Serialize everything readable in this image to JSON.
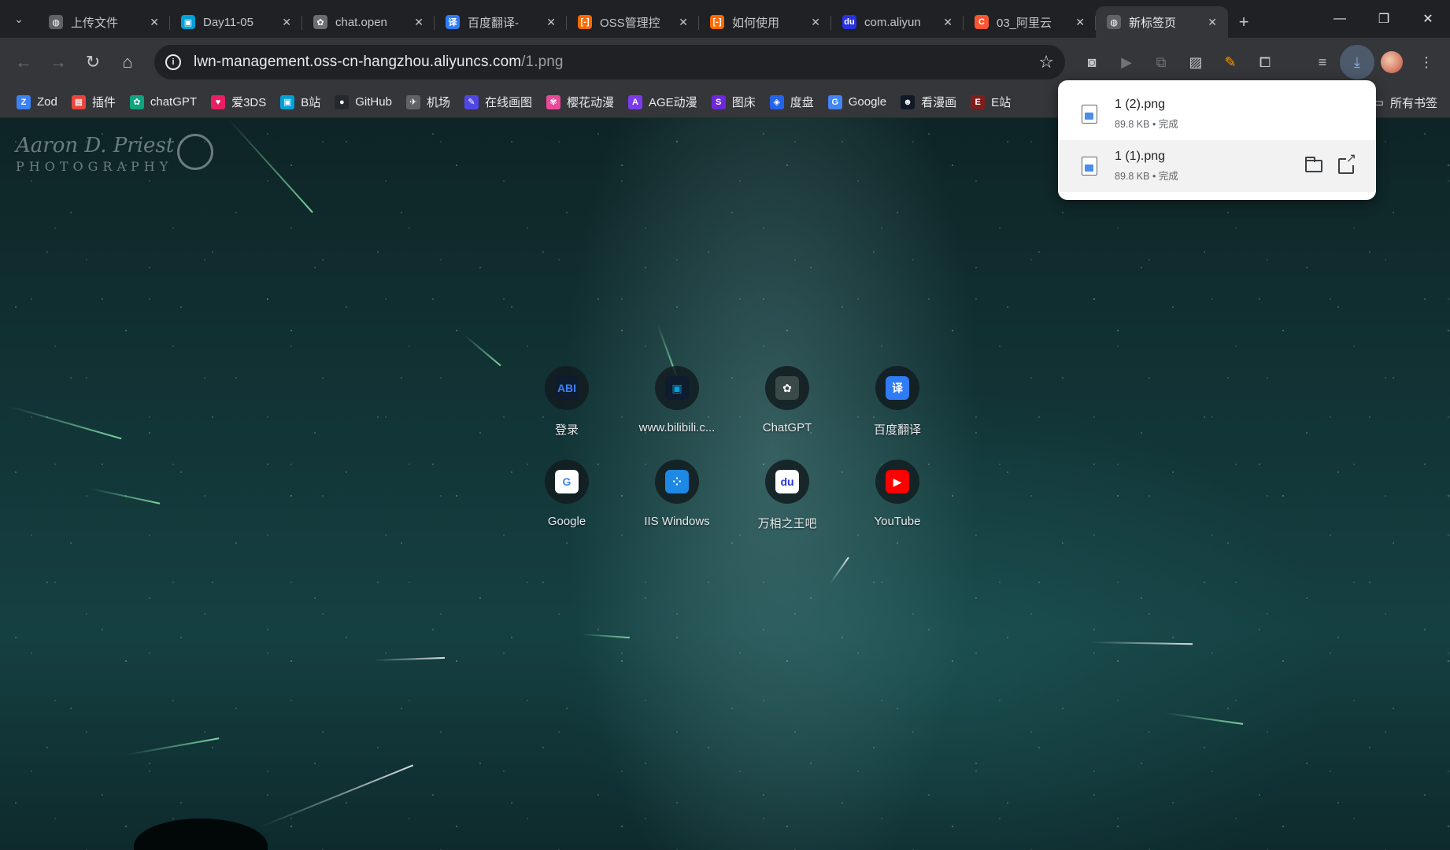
{
  "tabs": [
    {
      "title": "上传文件",
      "favicon": "globe-icon",
      "color": "#5f6368",
      "glyph": "◍"
    },
    {
      "title": "Day11-05",
      "favicon": "bilibili-icon",
      "color": "#00a1d6",
      "glyph": "▣"
    },
    {
      "title": "chat.open",
      "favicon": "openai-icon",
      "color": "#6b6f73",
      "glyph": "✿"
    },
    {
      "title": "百度翻译-",
      "favicon": "translate-icon",
      "color": "#2f7cf6",
      "glyph": "译"
    },
    {
      "title": "OSS管理控",
      "favicon": "aliyun-icon",
      "color": "#ff6a00",
      "glyph": "[-]"
    },
    {
      "title": "如何使用",
      "favicon": "aliyun-icon",
      "color": "#ff6a00",
      "glyph": "[-]"
    },
    {
      "title": "com.aliyun",
      "favicon": "baidu-icon",
      "color": "#2932e1",
      "glyph": "du"
    },
    {
      "title": "03_阿里云",
      "favicon": "csdn-icon",
      "color": "#fc5531",
      "glyph": "C"
    },
    {
      "title": "新标签页",
      "favicon": "globe-icon",
      "color": "#5f6368",
      "glyph": "◍",
      "active": true
    }
  ],
  "omnibox": {
    "host": "lwn-management.oss-cn-hangzhou.aliyuncs.com",
    "path": "/1.png"
  },
  "bookmarks": [
    {
      "label": "Zod",
      "color": "#3b82f6",
      "glyph": "Z"
    },
    {
      "label": "插件",
      "color": "#e8453c",
      "glyph": "▦"
    },
    {
      "label": "chatGPT",
      "color": "#10a37f",
      "glyph": "✿"
    },
    {
      "label": "爱3DS",
      "color": "#e91e63",
      "glyph": "♥"
    },
    {
      "label": "B站",
      "color": "#00a1d6",
      "glyph": "▣"
    },
    {
      "label": "GitHub",
      "color": "#24292e",
      "glyph": "●"
    },
    {
      "label": "机场",
      "color": "#5f6368",
      "glyph": "✈"
    },
    {
      "label": "在线画图",
      "color": "#4f46e5",
      "glyph": "✎"
    },
    {
      "label": "樱花动漫",
      "color": "#ec4899",
      "glyph": "✾"
    },
    {
      "label": "AGE动漫",
      "color": "#7c3aed",
      "glyph": "A"
    },
    {
      "label": "图床",
      "color": "#6d28d9",
      "glyph": "S"
    },
    {
      "label": "度盘",
      "color": "#2563eb",
      "glyph": "◈"
    },
    {
      "label": "Google",
      "color": "#4285f4",
      "glyph": "G"
    },
    {
      "label": "看漫画",
      "color": "#111827",
      "glyph": "☻"
    },
    {
      "label": "E站",
      "color": "#7f1d1d",
      "glyph": "E"
    }
  ],
  "all_bookmarks_label": "所有书签",
  "shortcuts": [
    {
      "label": "登录",
      "icon": "abi-icon",
      "bg": "#0f1b2e",
      "fg": "#3b82f6",
      "glyph": "ABI"
    },
    {
      "label": "www.bilibili.c...",
      "icon": "bilibili-icon",
      "bg": "#0f1b2e",
      "fg": "#00a1d6",
      "glyph": "▣"
    },
    {
      "label": "ChatGPT",
      "icon": "openai-icon",
      "bg": "#3a4a48",
      "fg": "#ffffff",
      "glyph": "✿"
    },
    {
      "label": "百度翻译",
      "icon": "translate-icon",
      "bg": "#2f7cf6",
      "fg": "#ffffff",
      "glyph": "译"
    },
    {
      "label": "Google",
      "icon": "google-icon",
      "bg": "#ffffff",
      "fg": "#4285f4",
      "glyph": "G"
    },
    {
      "label": "IIS Windows",
      "icon": "iis-icon",
      "bg": "#1e88e5",
      "fg": "#ffffff",
      "glyph": "⁘"
    },
    {
      "label": "万相之王吧",
      "icon": "baidu-paw-icon",
      "bg": "#ffffff",
      "fg": "#2932e1",
      "glyph": "du"
    },
    {
      "label": "YouTube",
      "icon": "youtube-icon",
      "bg": "#ff0000",
      "fg": "#ffffff",
      "glyph": "▶"
    }
  ],
  "watermark": {
    "line1": "Aaron D. Priest",
    "line2": "PHOTOGRAPHY"
  },
  "downloads": [
    {
      "name": "1 (2).png",
      "meta": "89.8 KB • 完成"
    },
    {
      "name": "1 (1).png",
      "meta": "89.8 KB • 完成"
    }
  ]
}
